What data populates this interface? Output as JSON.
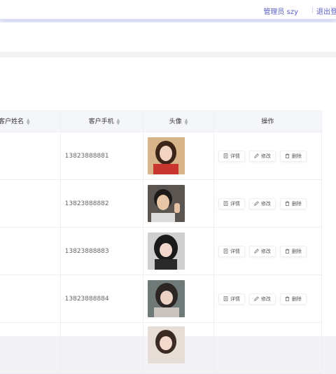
{
  "header": {
    "user_label": "管理员 szy",
    "logout_label": "退出登录"
  },
  "table": {
    "columns": {
      "name": "客户姓名",
      "phone": "客户手机",
      "avatar": "头像",
      "ops": "操作"
    },
    "rows": [
      {
        "phone": "13823888881"
      },
      {
        "phone": "13823888882"
      },
      {
        "phone": "13823888883"
      },
      {
        "phone": "13823888884"
      },
      {
        "phone": ""
      }
    ],
    "actions": {
      "detail": "详情",
      "edit": "修改",
      "delete": "删除"
    }
  },
  "colors": {
    "accent": "#5a5fc4",
    "header_bg": "#f5f6fa"
  }
}
